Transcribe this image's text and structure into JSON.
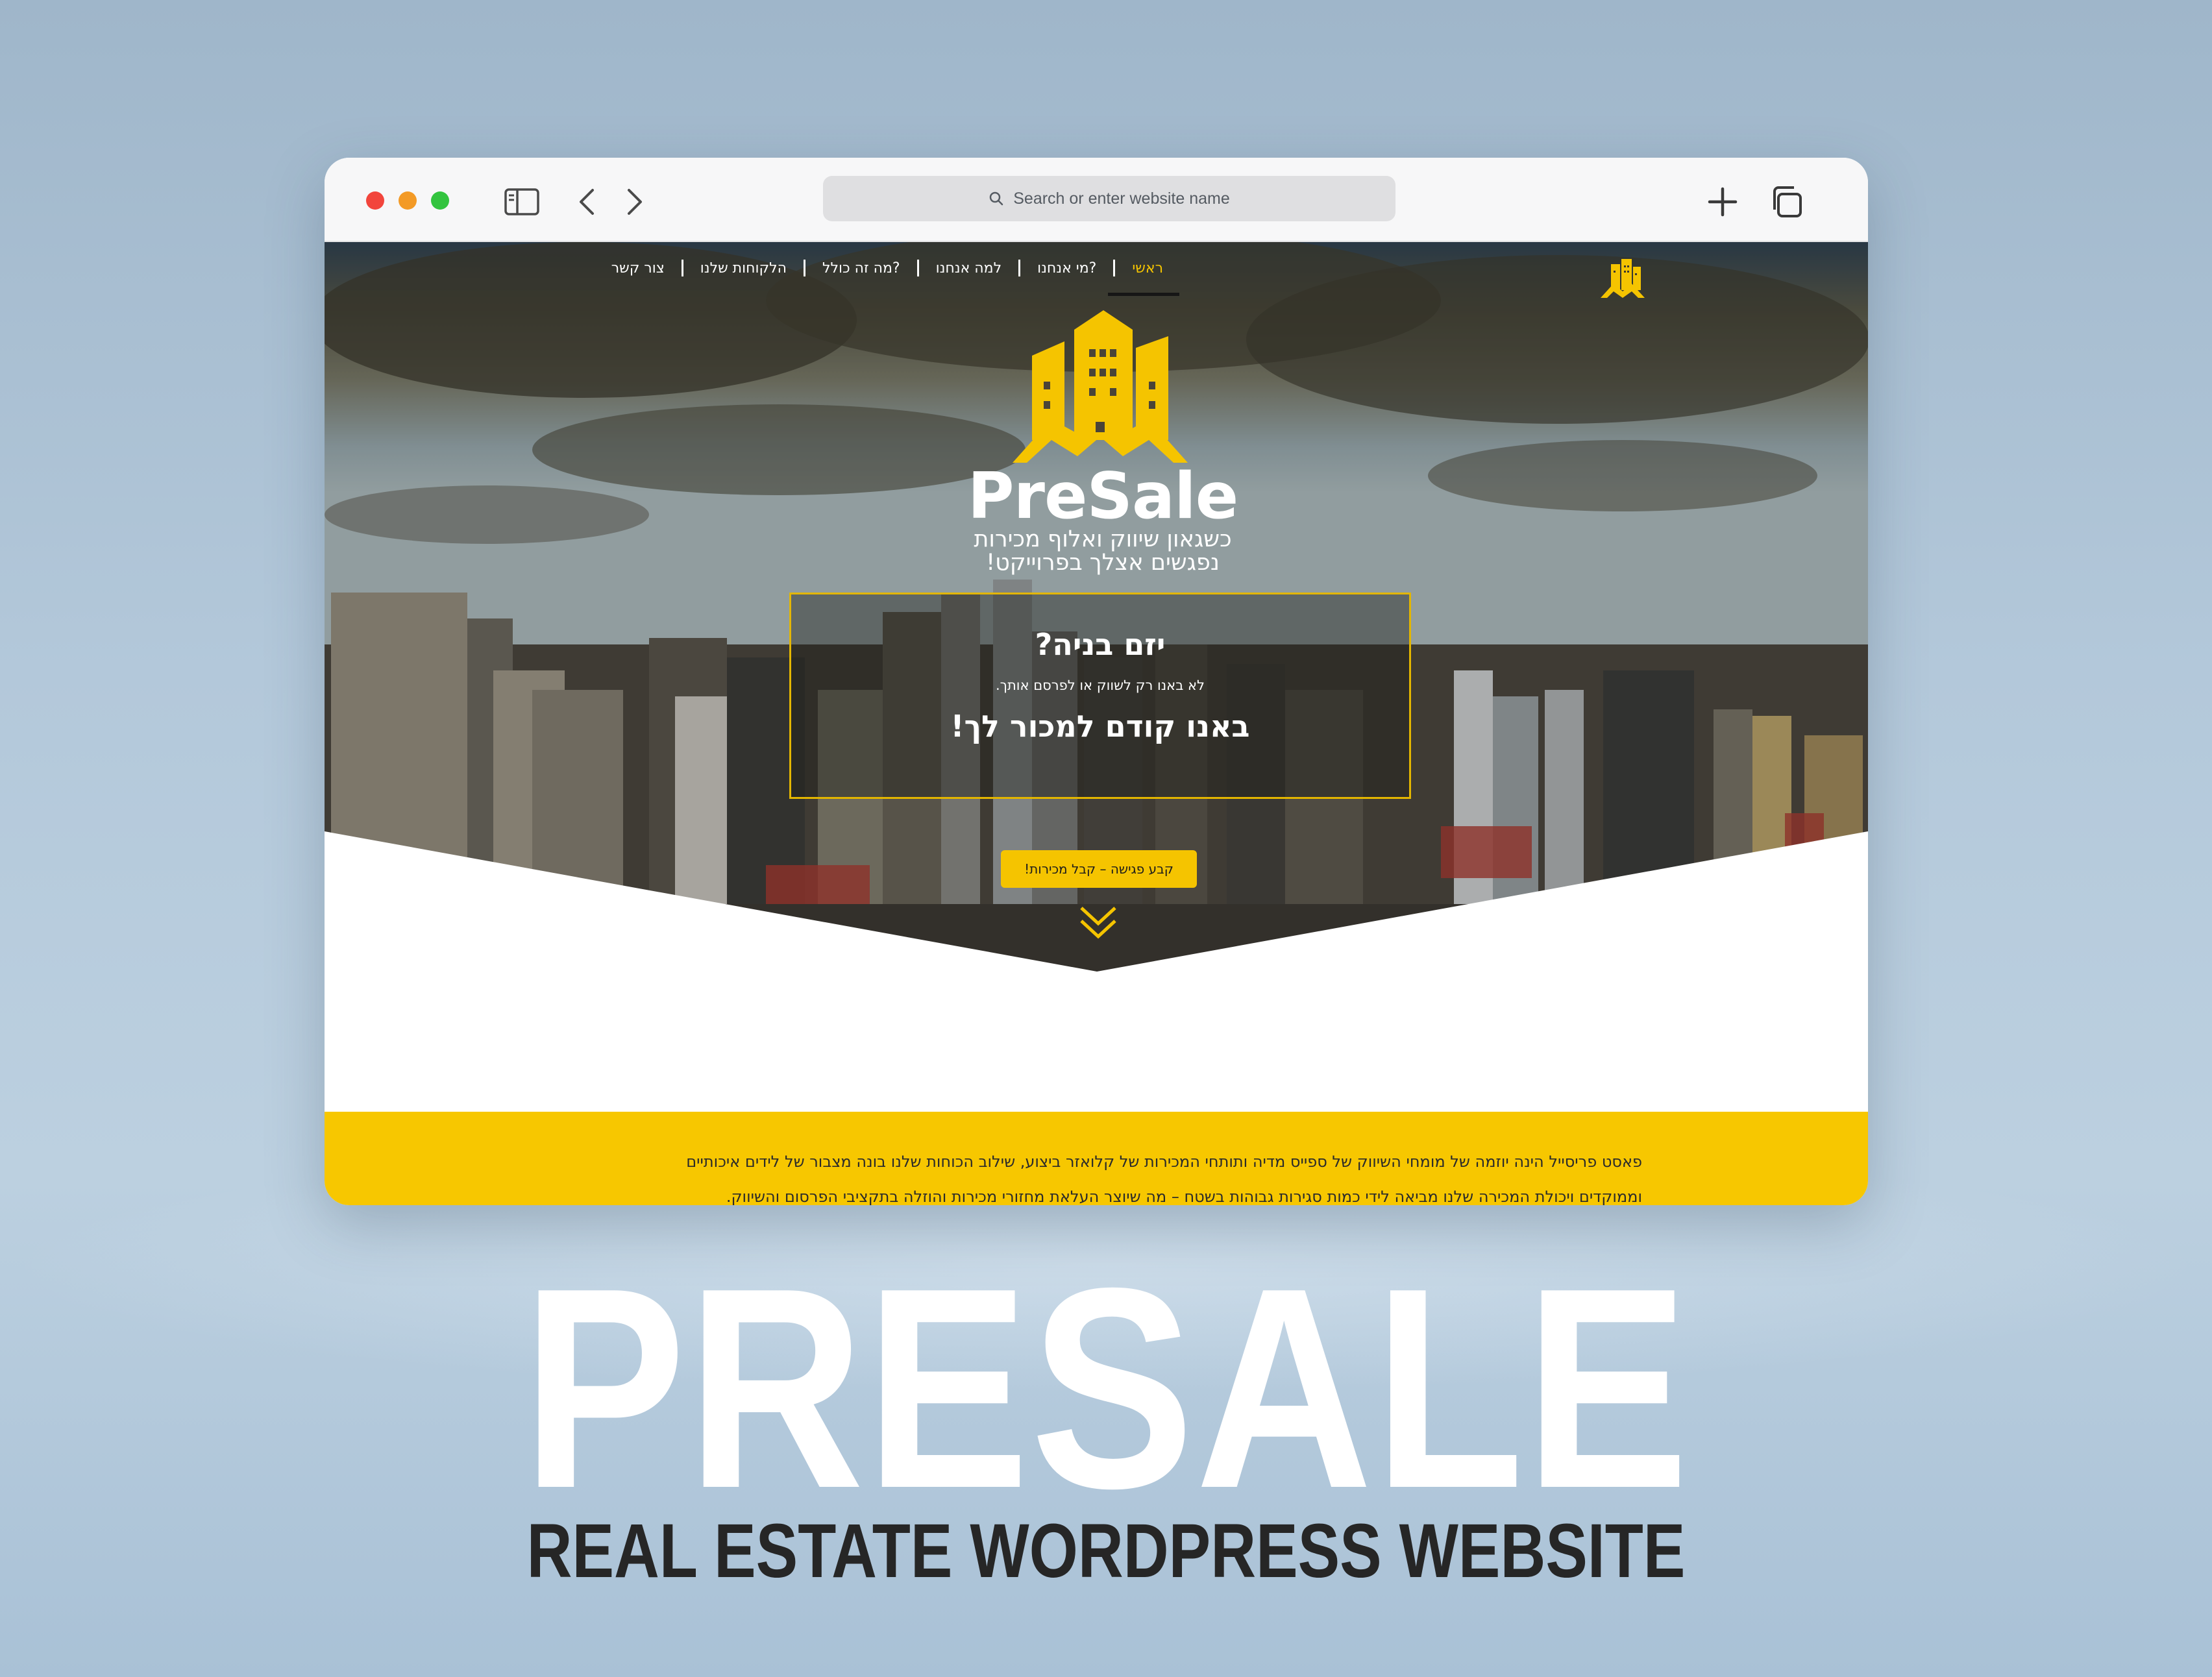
{
  "browser": {
    "address_placeholder": "Search or enter website name"
  },
  "nav": {
    "items": [
      {
        "label": "ראשי",
        "active": true
      },
      {
        "label": "מי אנחנו?"
      },
      {
        "label": "למה אנחנו"
      },
      {
        "label": "מה זה כולל?"
      },
      {
        "label": "הלקוחות שלנו"
      },
      {
        "label": "צור קשר"
      }
    ]
  },
  "hero": {
    "brand": "PreSale",
    "tagline_line1": "כשגאון שיווק ואלוף מכירות",
    "tagline_line2": "נפגשים אצלך בפרוייקט!",
    "question": "יזם בניה?",
    "subtext": "לא באנו רק לשווק או לפרסם אותך.",
    "headline": "באנו קודם למכור לך!",
    "cta_button": "קבע פגישה – קבל מכירות!"
  },
  "about": {
    "line1": "פאסט פריסייל הינה יוזמה של מומחי השיווק של ספייס מדיה ותותחי המכירות של קלואזר ביצוע, שילוב הכוחות שלנו בונה מצבור של לידים איכותיים",
    "line2": "וממוקדים ויכולת המכירה שלנו מביאה לידי כמות סגירות גבוהות בשטח – מה שיוצר העלאת מחזורי מכירות והוזלה בתקציבי הפרסום והשיווק."
  },
  "caption": {
    "title": "PRESALE",
    "subtitle": "REAL ESTATE WORDPRESS WEBSITE"
  },
  "colors": {
    "accent": "#f5c400",
    "band": "#f7c700",
    "dark": "#262626"
  }
}
